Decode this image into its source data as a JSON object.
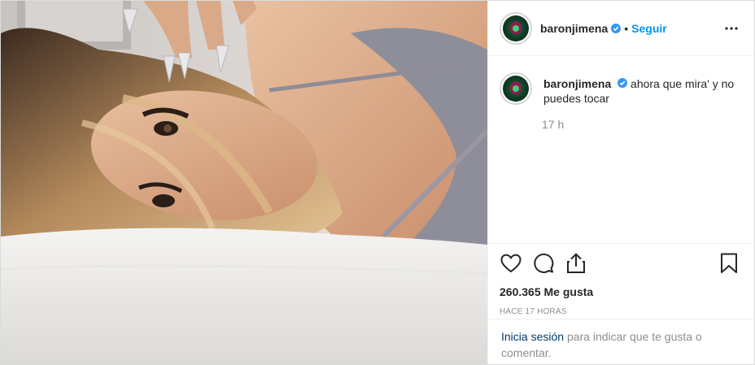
{
  "post": {
    "username": "baronjimena",
    "follow_label": "Seguir",
    "separator": "•",
    "caption": {
      "username": "baronjimena",
      "text": "ahora que mira' y no puedes tocar",
      "time": "17 h"
    },
    "likes": "260.365 Me gusta",
    "posted_ago": "HACE 17 HORAS",
    "login_prompt": {
      "link": "Inicia sesión",
      "text": "para indicar que te gusta o comentar."
    }
  },
  "icons": {
    "verified": "verified-badge-icon",
    "more": "more-options-icon",
    "like": "heart-icon",
    "comment": "comment-icon",
    "share": "share-icon",
    "save": "bookmark-icon"
  },
  "colors": {
    "accent": "#0095f6",
    "verified": "#3897f0",
    "text": "#262626",
    "muted": "#8e8e8e",
    "link_dark": "#00376b",
    "border": "#dbdbdb"
  }
}
